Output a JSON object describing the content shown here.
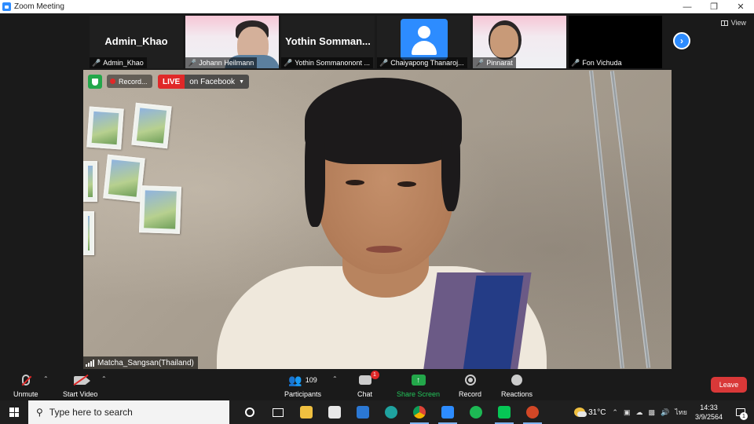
{
  "window": {
    "title": "Zoom Meeting",
    "controls": [
      "minimize-icon",
      "restore-icon",
      "close-icon"
    ]
  },
  "strip": {
    "view_label": "View",
    "participants": [
      {
        "big_name": "Admin_Khao",
        "label": "Admin_Khao",
        "video": false
      },
      {
        "big_name": "",
        "label": "Johann Heilmann",
        "video": true
      },
      {
        "big_name": "Yothin Somman...",
        "label": "Yothin Sommanonont ...",
        "video": false
      },
      {
        "big_name": "",
        "label": "Chaiyapong Thanaroj...",
        "video": false,
        "avatar": true
      },
      {
        "big_name": "",
        "label": "Pinnarat",
        "video": true
      },
      {
        "big_name": "",
        "label": "Fon Vichuda",
        "video": false
      }
    ]
  },
  "main_video": {
    "recording_label": "Record...",
    "live_label": "LIVE",
    "live_target": "on Facebook",
    "speaker_name": "Matcha_Sangsan(Thailand)"
  },
  "toolbar": {
    "unmute": "Unmute",
    "start_video": "Start Video",
    "participants": "Participants",
    "participant_count": "109",
    "chat": "Chat",
    "chat_badge": "1",
    "share_screen": "Share Screen",
    "record": "Record",
    "reactions": "Reactions",
    "leave": "Leave"
  },
  "taskbar": {
    "search_placeholder": "Type here to search",
    "temperature": "31°C",
    "language": "ไทย",
    "time": "14:33",
    "date": "3/9/2564",
    "notification_count": "1"
  },
  "colors": {
    "zoom_blue": "#2d8cff",
    "live_red": "#e02828",
    "share_green": "#23a74a",
    "leave_red": "#d93838"
  }
}
